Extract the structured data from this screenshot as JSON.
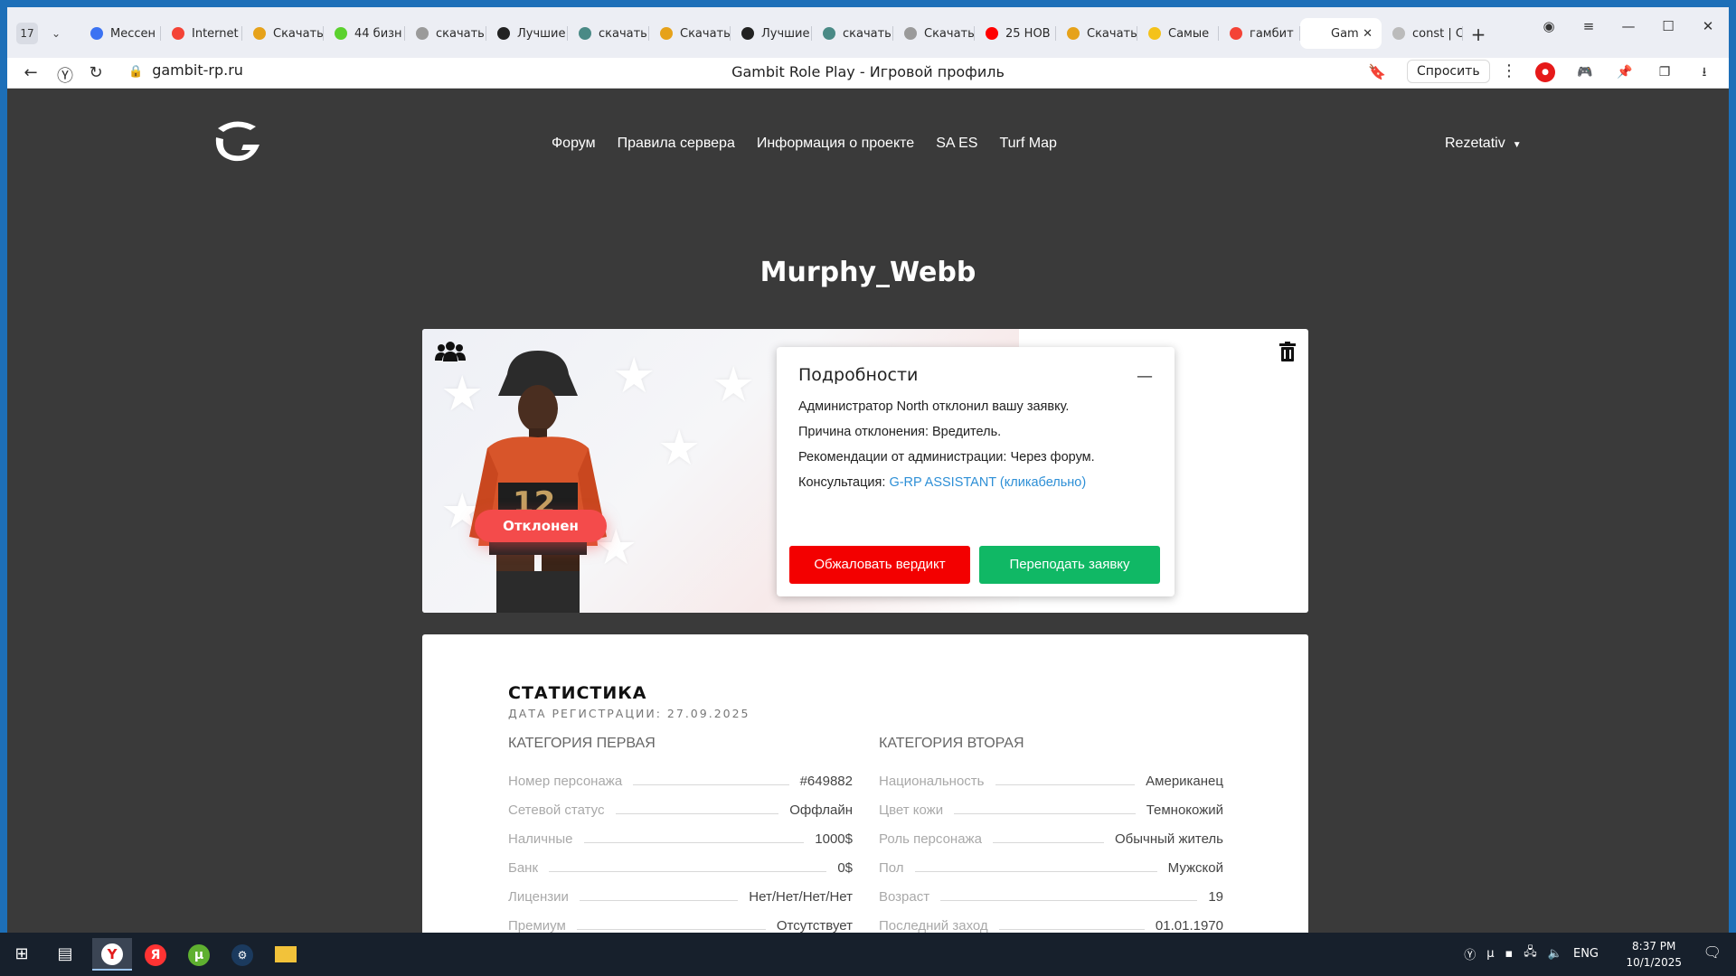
{
  "browser": {
    "tab_count": "17",
    "tabs": [
      {
        "label": "Мессен",
        "color": "#3b72f2"
      },
      {
        "label": "Internet",
        "color": "#f44336"
      },
      {
        "label": "Скачать",
        "color": "#e6a21a"
      },
      {
        "label": "44 бизн",
        "color": "#5bd12e"
      },
      {
        "label": "скачать",
        "color": "#9a9a9a"
      },
      {
        "label": "Лучшие",
        "color": "#222222"
      },
      {
        "label": "скачать",
        "color": "#4a8a86"
      },
      {
        "label": "Скачать",
        "color": "#e6a21a"
      },
      {
        "label": "Лучшие",
        "color": "#222222"
      },
      {
        "label": "скачать",
        "color": "#4a8a86"
      },
      {
        "label": "Скачать",
        "color": "#9a9a9a"
      },
      {
        "label": "25 НОВ",
        "color": "#ff0000"
      },
      {
        "label": "Скачать",
        "color": "#e6a21a"
      },
      {
        "label": "Самые",
        "color": "#f4c21a"
      },
      {
        "label": "гамбит",
        "color": "#f44336"
      },
      {
        "label": "Gam",
        "color": "#ffffff",
        "active": true
      },
      {
        "label": "const | C",
        "color": "#bbbbbb"
      }
    ],
    "url": "gambit-rp.ru",
    "page_title": "Gambit Role Play - Игровой профиль",
    "ask_label": "Спросить"
  },
  "site": {
    "nav": [
      "Форум",
      "Правила сервера",
      "Информация о проекте",
      "SA ES",
      "Turf Map"
    ],
    "user": "Rezetativ"
  },
  "profile": {
    "name": "Murphy_Webb",
    "status_badge": "Отклонен",
    "details": {
      "title": "Подробности",
      "line1": "Администратор North отклонил вашу заявку.",
      "line2": "Причина отклонения: Вредитель.",
      "line3": "Рекомендации от администрации: Через форум.",
      "line4_prefix": "Консультация: ",
      "line4_link": "G-RP ASSISTANT (кликабельно)",
      "appeal_button": "Обжаловать вердикт",
      "resubmit_button": "Переподать заявку"
    }
  },
  "stats": {
    "title": "СТАТИСТИКА",
    "reg_date": "ДАТА РЕГИСТРАЦИИ: 27.09.2025",
    "cat1": {
      "title": "КАТЕГОРИЯ ПЕРВАЯ",
      "rows": [
        {
          "k": "Номер персонажа",
          "v": "#649882"
        },
        {
          "k": "Сетевой статус",
          "v": "Оффлайн"
        },
        {
          "k": "Наличные",
          "v": "1000$"
        },
        {
          "k": "Банк",
          "v": "0$"
        },
        {
          "k": "Лицензии",
          "v": "Нет/Нет/Нет/Нет"
        },
        {
          "k": "Премиум",
          "v": "Отсутствует"
        }
      ]
    },
    "cat2": {
      "title": "КАТЕГОРИЯ ВТОРАЯ",
      "rows": [
        {
          "k": "Национальность",
          "v": "Американец"
        },
        {
          "k": "Цвет кожи",
          "v": "Темнокожий"
        },
        {
          "k": "Роль персонажа",
          "v": "Обычный житель"
        },
        {
          "k": "Пол",
          "v": "Мужской"
        },
        {
          "k": "Возраст",
          "v": "19"
        },
        {
          "k": "Последний заход",
          "v": "01.01.1970"
        }
      ]
    }
  },
  "taskbar": {
    "lang": "ENG",
    "time": "8:37 PM",
    "date": "10/1/2025"
  }
}
